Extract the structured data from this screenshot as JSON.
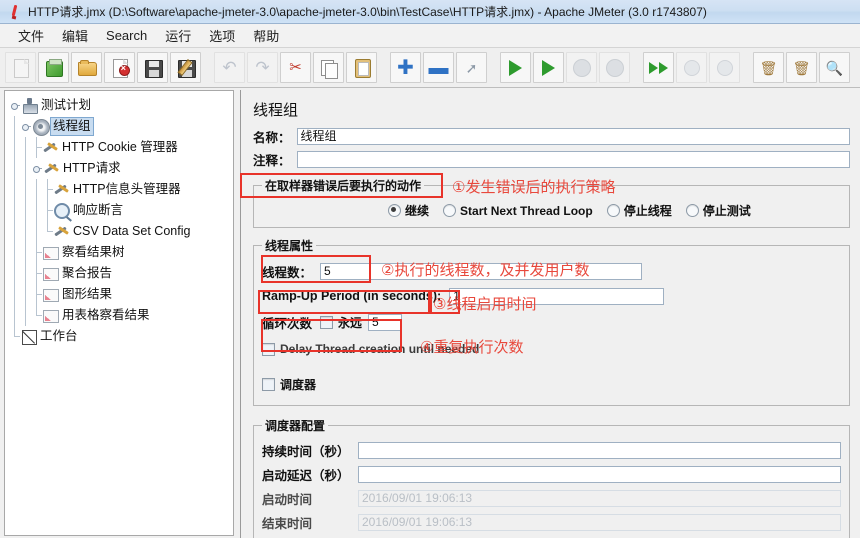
{
  "window": {
    "title": "HTTP请求.jmx (D:\\Software\\apache-jmeter-3.0\\apache-jmeter-3.0\\bin\\TestCase\\HTTP请求.jmx) - Apache JMeter (3.0 r1743807)",
    "icon": "jmeter-feather-icon"
  },
  "menubar": {
    "items": [
      {
        "label": "文件",
        "name": "menu-file"
      },
      {
        "label": "编辑",
        "name": "menu-edit"
      },
      {
        "label": "Search",
        "name": "menu-search"
      },
      {
        "label": "运行",
        "name": "menu-run"
      },
      {
        "label": "选项",
        "name": "menu-options"
      },
      {
        "label": "帮助",
        "name": "menu-help"
      }
    ]
  },
  "toolbar": {
    "buttons": [
      {
        "name": "new-button",
        "icon": "new-document-icon",
        "enabled": false
      },
      {
        "name": "templates-button",
        "icon": "templates-icon",
        "enabled": true
      },
      {
        "name": "open-button",
        "icon": "open-folder-icon",
        "enabled": true
      },
      {
        "name": "close-button",
        "icon": "close-document-icon",
        "enabled": true
      },
      {
        "name": "save-button",
        "icon": "save-disk-icon",
        "enabled": true
      },
      {
        "name": "save-as-button",
        "icon": "save-as-icon",
        "enabled": true
      },
      {
        "name": "undo-button",
        "icon": "undo-arrow-icon",
        "enabled": false
      },
      {
        "name": "redo-button",
        "icon": "redo-arrow-icon",
        "enabled": false
      },
      {
        "name": "cut-button",
        "icon": "scissors-icon",
        "enabled": true
      },
      {
        "name": "copy-button",
        "icon": "copy-icon",
        "enabled": true
      },
      {
        "name": "paste-button",
        "icon": "clipboard-paste-icon",
        "enabled": true
      },
      {
        "name": "expand-all-button",
        "icon": "plus-icon",
        "enabled": true
      },
      {
        "name": "collapse-all-button",
        "icon": "minus-icon",
        "enabled": true
      },
      {
        "name": "toggle-button",
        "icon": "toggle-switch-icon",
        "enabled": true
      },
      {
        "name": "start-button",
        "icon": "play-green-triangle-icon",
        "enabled": true
      },
      {
        "name": "start-no-pause-button",
        "icon": "play-no-pause-icon",
        "enabled": true
      },
      {
        "name": "stop-button",
        "icon": "stop-octagon-icon",
        "enabled": false
      },
      {
        "name": "shutdown-button",
        "icon": "shutdown-icon",
        "enabled": false
      },
      {
        "name": "remote-start-all-button",
        "icon": "remote-start-all-icon",
        "enabled": true
      },
      {
        "name": "remote-stop-all-button",
        "icon": "remote-stop-all-icon",
        "enabled": false
      },
      {
        "name": "remote-shutdown-all-button",
        "icon": "remote-shutdown-all-icon",
        "enabled": false
      },
      {
        "name": "clear-button",
        "icon": "clear-broom-icon",
        "enabled": true
      },
      {
        "name": "clear-all-button",
        "icon": "clear-all-broom-icon",
        "enabled": true
      },
      {
        "name": "search-button",
        "icon": "search-magnifier-icon",
        "enabled": true
      }
    ]
  },
  "tree": {
    "nodes": [
      {
        "label": "测试计划",
        "icon": "test-plan-icon",
        "depth": 0,
        "name": "tree-node-test-plan",
        "selected": false,
        "expanded": true
      },
      {
        "label": "线程组",
        "icon": "thread-group-gear-icon",
        "depth": 1,
        "name": "tree-node-thread-group",
        "selected": true,
        "expanded": true
      },
      {
        "label": "HTTP Cookie 管理器",
        "icon": "config-wrench-icon",
        "depth": 2,
        "name": "tree-node-http-cookie-manager",
        "selected": false
      },
      {
        "label": "HTTP请求",
        "icon": "http-sampler-icon",
        "depth": 2,
        "name": "tree-node-http-request",
        "selected": false,
        "expanded": true
      },
      {
        "label": "HTTP信息头管理器",
        "icon": "config-wrench-icon",
        "depth": 3,
        "name": "tree-node-http-header-manager",
        "selected": false
      },
      {
        "label": "响应断言",
        "icon": "assertion-magnifier-icon",
        "depth": 3,
        "name": "tree-node-response-assertion",
        "selected": false
      },
      {
        "label": "CSV Data Set Config",
        "icon": "config-wrench-icon",
        "depth": 3,
        "name": "tree-node-csv-data-set-config",
        "selected": false
      },
      {
        "label": "察看结果树",
        "icon": "listener-chart-icon",
        "depth": 2,
        "name": "tree-node-view-results-tree",
        "selected": false
      },
      {
        "label": "聚合报告",
        "icon": "listener-chart-icon",
        "depth": 2,
        "name": "tree-node-aggregate-report",
        "selected": false
      },
      {
        "label": "图形结果",
        "icon": "listener-chart-icon",
        "depth": 2,
        "name": "tree-node-graph-results",
        "selected": false
      },
      {
        "label": "用表格察看结果",
        "icon": "listener-chart-icon",
        "depth": 2,
        "name": "tree-node-view-results-in-table",
        "selected": false
      },
      {
        "label": "工作台",
        "icon": "workbench-icon",
        "depth": 0,
        "name": "tree-node-workbench",
        "selected": false
      }
    ]
  },
  "editor": {
    "title": "线程组",
    "name_label": "名称：",
    "name_value": "线程组",
    "comment_label": "注释：",
    "comment_value": "",
    "on_error_legend": "在取样器错误后要执行的动作",
    "on_error_options": [
      {
        "label": "继续",
        "selected": true,
        "name": "radio-continue"
      },
      {
        "label": "Start Next Thread Loop",
        "selected": false,
        "name": "radio-start-next-thread-loop"
      },
      {
        "label": "停止线程",
        "selected": false,
        "name": "radio-stop-thread"
      },
      {
        "label": "停止测试",
        "selected": false,
        "name": "radio-stop-test"
      }
    ],
    "thread_props_legend": "线程属性",
    "thread_count_label": "线程数：",
    "thread_count_value": "5",
    "ramp_up_label": "Ramp-Up Period (in seconds):",
    "ramp_up_value": "1",
    "loop_count_label": "循环次数",
    "loop_forever_label": "永远",
    "loop_forever_checked": false,
    "loop_count_value": "5",
    "delay_thread_label": "Delay Thread creation until needed",
    "delay_thread_checked": false,
    "scheduler_label": "调度器",
    "scheduler_checked": false,
    "scheduler_legend": "调度器配置",
    "duration_label": "持续时间（秒）",
    "duration_value": "",
    "startup_delay_label": "启动延迟（秒）",
    "startup_delay_value": "",
    "start_time_label": "启动时间",
    "start_time_value": "2016/09/01 19:06:13",
    "end_time_label": "结束时间",
    "end_time_value": "2016/09/01 19:06:13"
  },
  "annotations": {
    "color": "#e8332a",
    "items": [
      {
        "name": "annotation-1-error-strategy",
        "text": "①发生错误后的执行策略"
      },
      {
        "name": "annotation-2-thread-count",
        "text": "②执行的线程数，及并发用户数"
      },
      {
        "name": "annotation-3-rampup",
        "text": "③线程启用时间"
      },
      {
        "name": "annotation-4-loop-count",
        "text": "④重复执行次数"
      }
    ]
  }
}
